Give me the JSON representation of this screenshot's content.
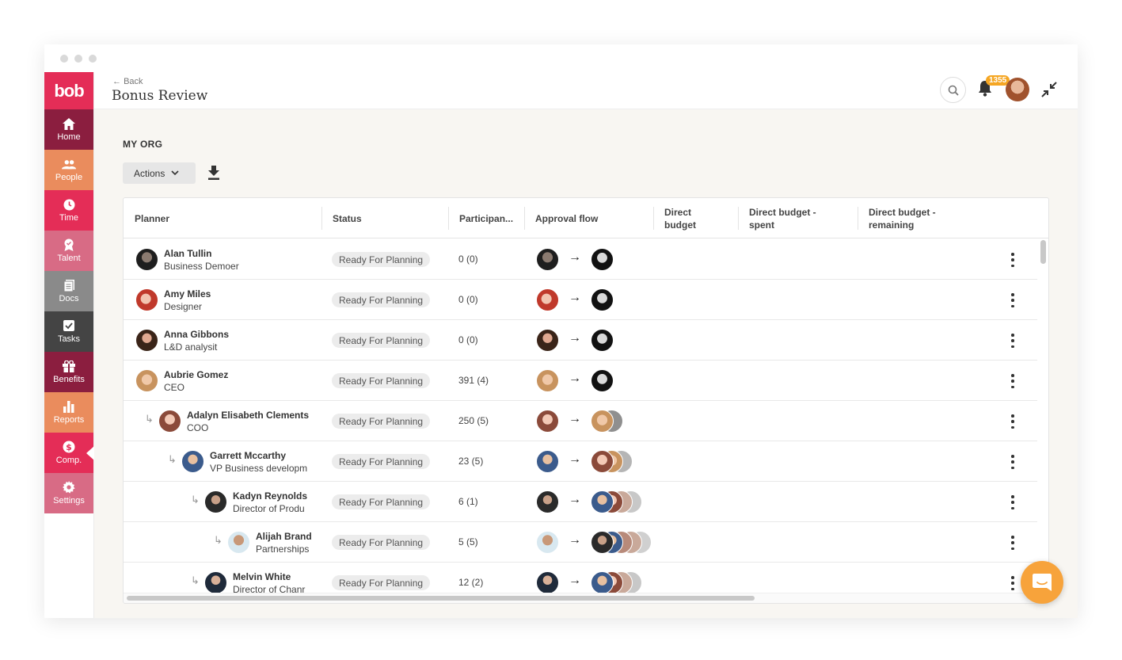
{
  "app": {
    "logo": "bob",
    "back_label": "Back",
    "page_title": "Bonus Review"
  },
  "header": {
    "notification_count": "1355"
  },
  "sidebar": {
    "items": [
      {
        "label": "Home",
        "color": "#8b1e3f",
        "icon": "home-icon"
      },
      {
        "label": "People",
        "color": "#ea8c5d",
        "icon": "people-icon"
      },
      {
        "label": "Time",
        "color": "#e42d57",
        "icon": "clock-icon"
      },
      {
        "label": "Talent",
        "color": "#d86b85",
        "icon": "award-icon"
      },
      {
        "label": "Docs",
        "color": "#8a8a8a",
        "icon": "document-icon"
      },
      {
        "label": "Tasks",
        "color": "#444444",
        "icon": "checkbox-icon"
      },
      {
        "label": "Benefits",
        "color": "#8b1e3f",
        "icon": "gift-icon"
      },
      {
        "label": "Reports",
        "color": "#ea8c5d",
        "icon": "bar-chart-icon"
      },
      {
        "label": "Comp.",
        "color": "#e42d57",
        "icon": "dollar-icon"
      },
      {
        "label": "Settings",
        "color": "#d86b85",
        "icon": "gear-icon"
      }
    ]
  },
  "main": {
    "section_title": "MY ORG",
    "actions_label": "Actions"
  },
  "table": {
    "columns": {
      "planner": "Planner",
      "status": "Status",
      "participants": "Participan...",
      "approval_flow": "Approval flow",
      "direct_budget_1": "Direct",
      "direct_budget_2": "budget",
      "spent_1": "Direct budget -",
      "spent_2": "spent",
      "remaining_1": "Direct budget -",
      "remaining_2": "remaining"
    },
    "rows": [
      {
        "name": "Alan Tullin",
        "role": "Business Demoer",
        "status": "Ready For Planning",
        "participants": "0 (0)"
      },
      {
        "name": "Amy Miles",
        "role": "Designer",
        "status": "Ready For Planning",
        "participants": "0 (0)"
      },
      {
        "name": "Anna Gibbons",
        "role": "L&D analysit",
        "status": "Ready For Planning",
        "participants": "0 (0)"
      },
      {
        "name": "Aubrie Gomez",
        "role": "CEO",
        "status": "Ready For Planning",
        "participants": "391 (4)"
      },
      {
        "name": "Adalyn Elisabeth Clements",
        "role": "COO",
        "status": "Ready For Planning",
        "participants": "250 (5)"
      },
      {
        "name": "Garrett Mccarthy",
        "role": "VP Business developm",
        "status": "Ready For Planning",
        "participants": "23 (5)"
      },
      {
        "name": "Kadyn Reynolds",
        "role": "Director of Produ",
        "status": "Ready For Planning",
        "participants": "6 (1)"
      },
      {
        "name": "Alijah Brand",
        "role": "Partnerships",
        "status": "Ready For Planning",
        "participants": "5 (5)"
      },
      {
        "name": "Melvin White",
        "role": "Director of Chanr",
        "status": "Ready For Planning",
        "participants": "12 (2)"
      }
    ],
    "flow_arrow": "→"
  }
}
